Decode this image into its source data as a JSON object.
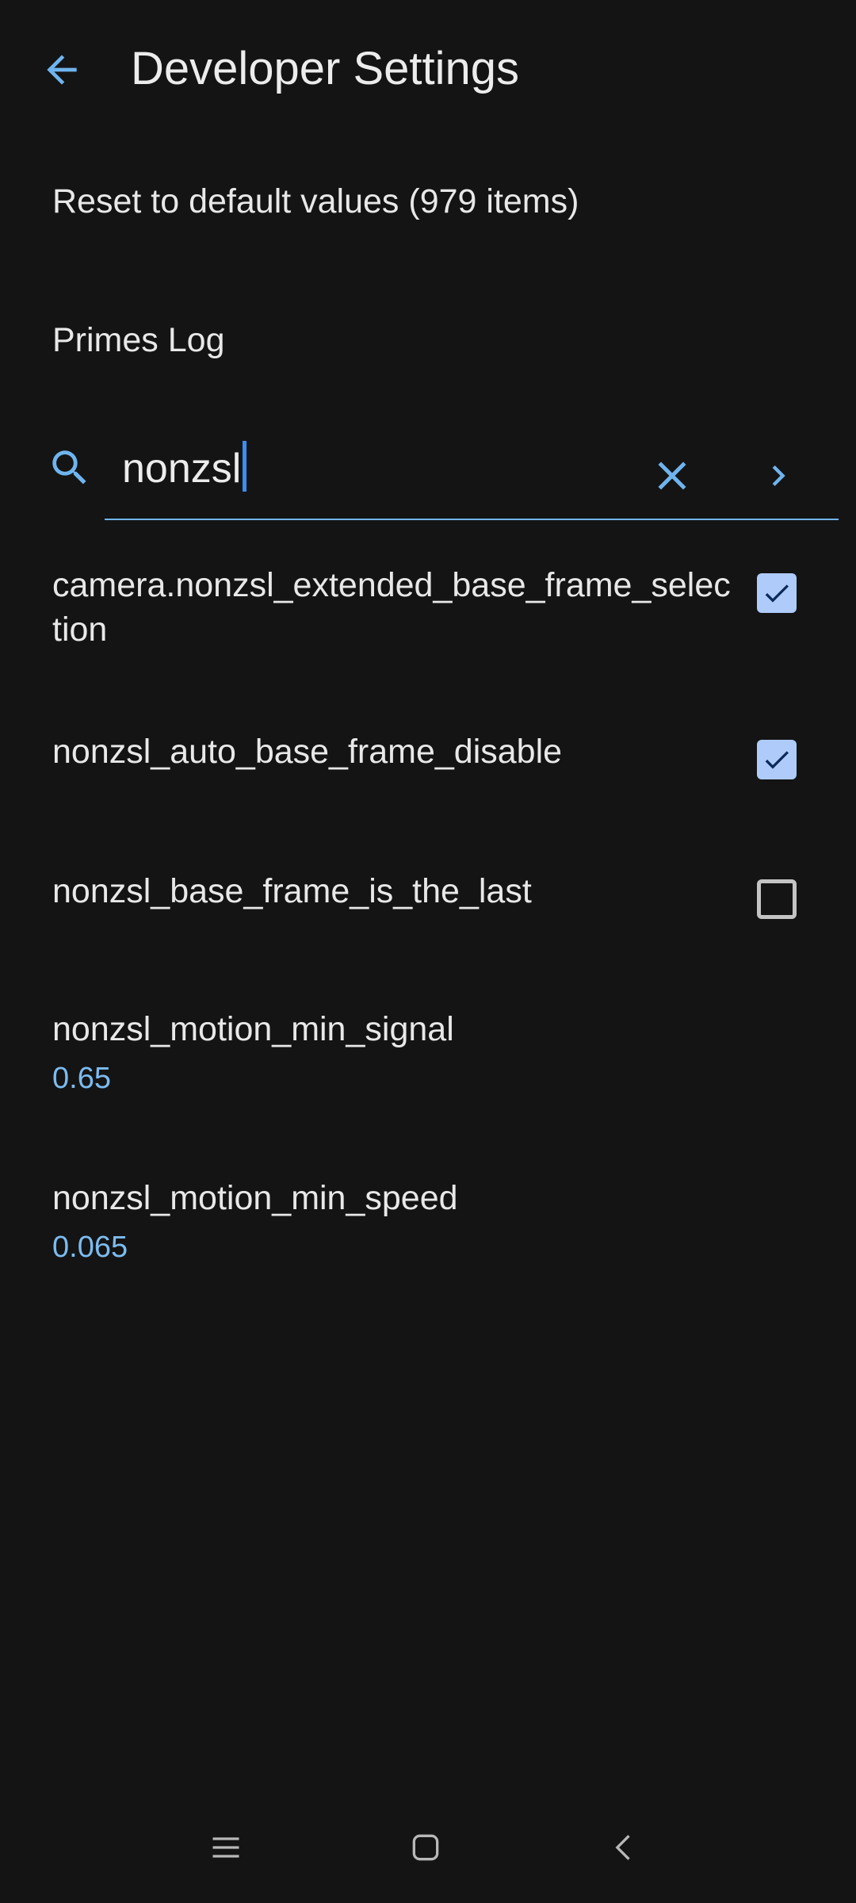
{
  "header": {
    "title": "Developer Settings",
    "back_icon": "arrow-back-icon"
  },
  "actions": {
    "reset_label": "Reset to default values (979 items)",
    "primes_log_label": "Primes Log"
  },
  "search": {
    "query": "nonzsl",
    "icons": [
      "search-icon",
      "clear-icon",
      "chevron-right-icon"
    ]
  },
  "flags": [
    {
      "label": "camera.nonzsl_extended_base_frame_selection",
      "checked": true
    },
    {
      "label": "nonzsl_auto_base_frame_disable",
      "checked": true
    },
    {
      "label": "nonzsl_base_frame_is_the_last",
      "checked": false
    }
  ],
  "values": [
    {
      "label": "nonzsl_motion_min_signal",
      "value": "0.65"
    },
    {
      "label": "nonzsl_motion_min_speed",
      "value": "0.065"
    }
  ],
  "nav": {
    "icons": [
      "recents-icon",
      "home-icon",
      "back-icon"
    ]
  },
  "colors": {
    "background": "#141414",
    "accent": "#6fb4ee",
    "checkbox_fill": "#aecbfa",
    "value_text": "#7cbcf0"
  }
}
